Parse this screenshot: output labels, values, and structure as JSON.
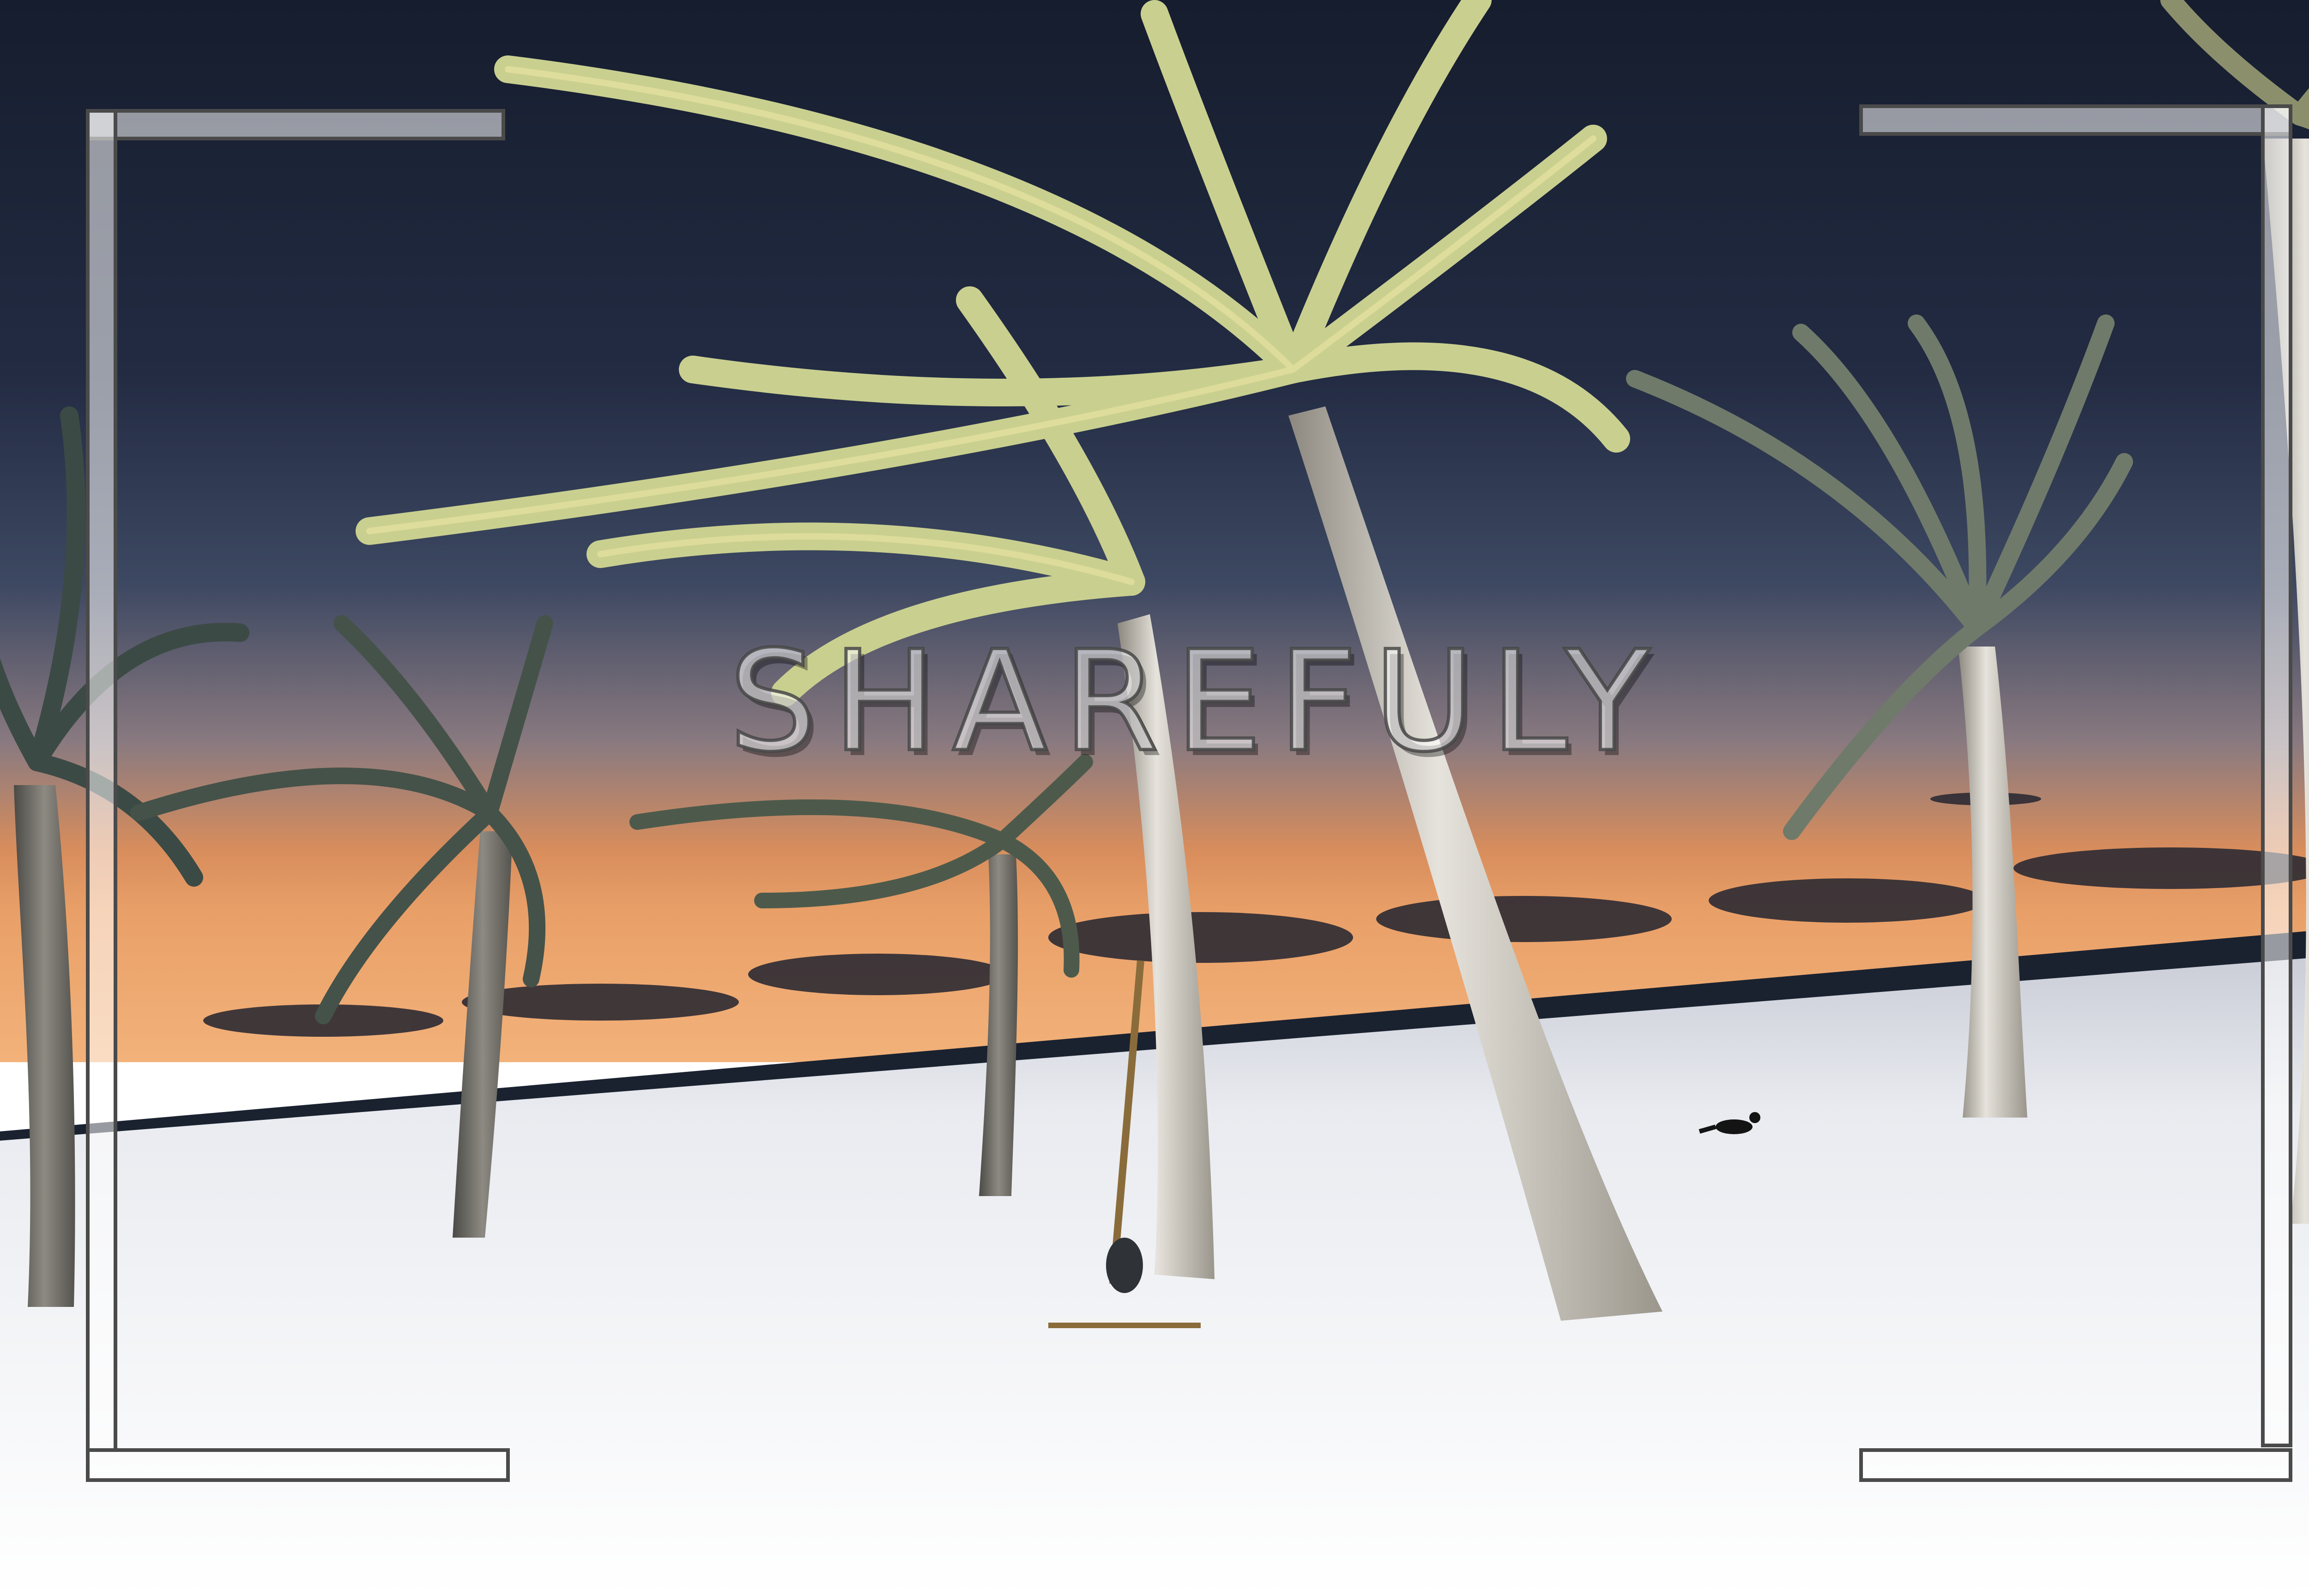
{
  "watermark": {
    "text": "SHAREFULY"
  },
  "photo": {
    "subject": "beach-sunset-with-palm-trees",
    "colors": {
      "sky_top": "#1b2336",
      "sky_mid": "#3b4660",
      "horizon_glow": "#e7955b",
      "sea": "#1a2230",
      "sand": "#f1f2f5",
      "palm_leaf": "#c9cf8f",
      "palm_trunk": "#d9d6cf"
    }
  }
}
